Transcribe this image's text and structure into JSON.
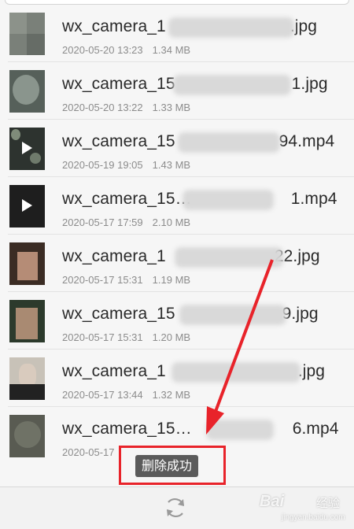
{
  "files": [
    {
      "name_start": "wx_camera_1",
      "name_end": ".jpg",
      "date": "2020-05-20 13:23",
      "size": "1.34 MB",
      "type": "image"
    },
    {
      "name_start": "wx_camera_15",
      "name_end": "1.jpg",
      "date": "2020-05-20 13:22",
      "size": "1.33 MB",
      "type": "image"
    },
    {
      "name_start": "wx_camera_15",
      "name_end": "94.mp4",
      "date": "2020-05-19 19:05",
      "size": "1.43 MB",
      "type": "video"
    },
    {
      "name_start": "wx_camera_15…",
      "name_end": "1.mp4",
      "date": "2020-05-17 17:59",
      "size": "2.10 MB",
      "type": "video"
    },
    {
      "name_start": "wx_camera_1",
      "name_end": "22.jpg",
      "date": "2020-05-17 15:31",
      "size": "1.19 MB",
      "type": "image"
    },
    {
      "name_start": "wx_camera_15",
      "name_end": "9.jpg",
      "date": "2020-05-17 15:31",
      "size": "1.20 MB",
      "type": "image"
    },
    {
      "name_start": "wx_camera_1",
      "name_end": ".jpg",
      "date": "2020-05-17 13:44",
      "size": "1.32 MB",
      "type": "image"
    },
    {
      "name_start": "wx_camera_15…",
      "name_end": "6.mp4",
      "date": "2020-05-17",
      "size": "",
      "type": "video"
    }
  ],
  "toast": {
    "text": "删除成功"
  },
  "bottom_bar": {
    "refresh_icon": "refresh-icon"
  },
  "watermark": {
    "logo": "Bai",
    "brand": "经验",
    "url": "jingyan.baidu.com"
  },
  "colors": {
    "annotation": "#e8232a",
    "background": "#f6f6f6"
  }
}
